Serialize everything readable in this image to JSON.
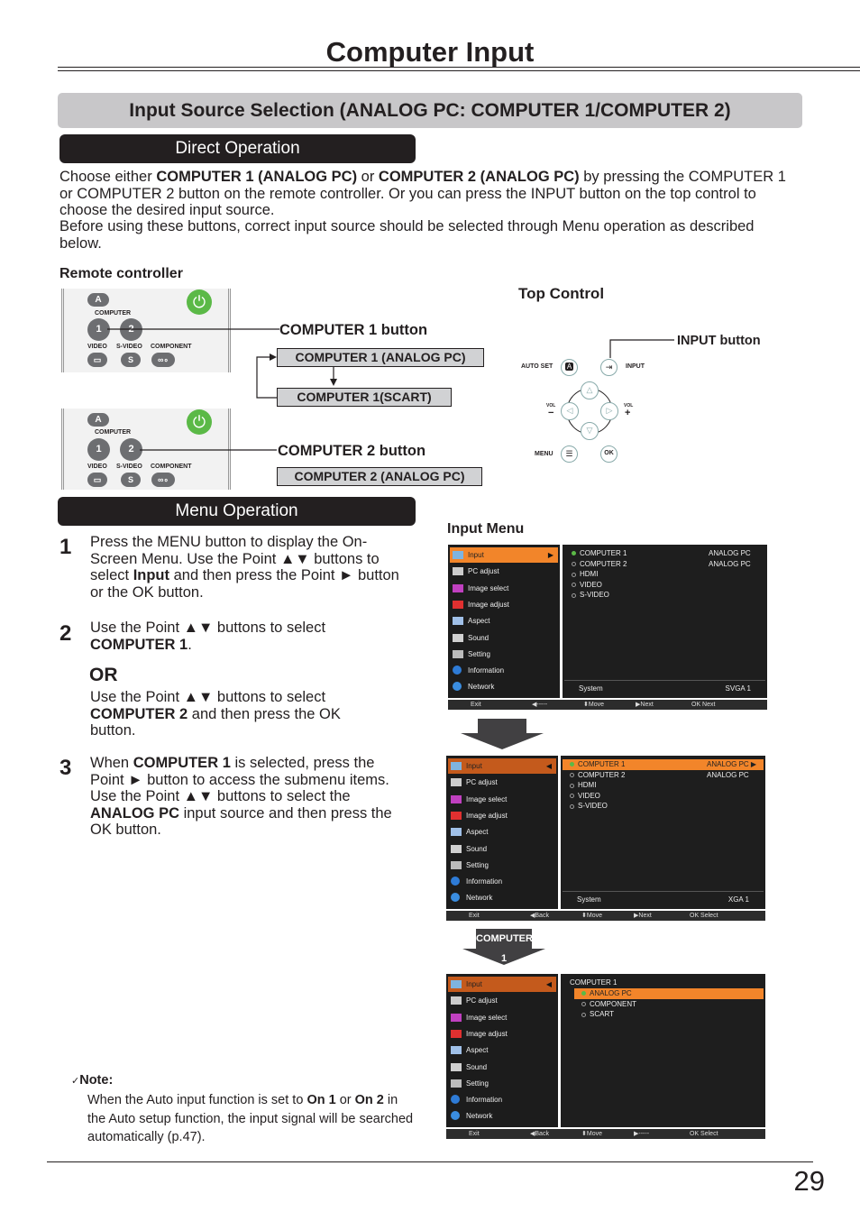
{
  "page": {
    "title": "Computer Input",
    "section_title": "Input Source Selection (ANALOG PC: COMPUTER 1/COMPUTER 2)",
    "page_number": "29"
  },
  "direct": {
    "heading": "Direct Operation",
    "para1_a": "Choose either ",
    "para1_b": "COMPUTER 1 (ANALOG PC)",
    "para1_c": " or ",
    "para1_d": "COMPUTER 2 (ANALOG PC)",
    "para1_e": " by pressing the COMPUTER 1 or COMPUTER 2 button on the remote controller. Or you can press the INPUT button on the top control to choose the desired input source.",
    "para2": "Before using these buttons, correct input source should be selected through Menu operation as described below.",
    "remote_label": "Remote controller",
    "top_control_label": "Top Control",
    "computer1_button": "COMPUTER 1 button",
    "computer1_analog": "COMPUTER 1 (ANALOG PC)",
    "computer1_scart": "COMPUTER 1(SCART)",
    "computer2_button": "COMPUTER 2 button",
    "computer2_analog": "COMPUTER 2 (ANALOG PC)",
    "input_button": "INPUT button"
  },
  "remote": {
    "auto_key": "A",
    "computer_label": "COMPUTER",
    "comp1": "1",
    "comp2": "2",
    "video": "VIDEO",
    "svideo": "S-VIDEO",
    "component": "COMPONENT",
    "power_glyph": "⏻",
    "video_glyph": "▭",
    "svideo_glyph": "S",
    "component_glyph": "∞∘"
  },
  "top_control": {
    "auto_set": "AUTO SET",
    "auto_key": "A",
    "input": "INPUT",
    "input_glyph": "⇥",
    "vol_minus_label": "VOL",
    "vol_minus": "−",
    "vol_plus_label": "VOL",
    "vol_plus": "+",
    "menu": "MENU",
    "menu_glyph": "☰",
    "ok": "OK",
    "up": "△",
    "down": "▽",
    "left": "◁",
    "right": "▷"
  },
  "menu_op": {
    "heading": "Menu Operation",
    "input_menu_label": "Input Menu",
    "step1_num": "1",
    "step1_a": "Press the MENU button to display the On-Screen Menu. Use the Point ▲▼ buttons to select ",
    "step1_b": "Input",
    "step1_c": " and then press the Point ► button or the OK button.",
    "step2_num": "2",
    "step2_a": "Use the Point ▲▼ buttons to select ",
    "step2_b": "COMPUTER 1",
    "step2_c": ".",
    "or": "OR",
    "step2alt_a": "Use the Point ▲▼ buttons to select ",
    "step2alt_b": "COMPUTER 2",
    "step2alt_c": " and then press the OK button.",
    "step3_num": "3",
    "step3_a": "When ",
    "step3_b": "COMPUTER 1",
    "step3_c": " is selected, press the Point ► button to access the submenu items. Use the Point ▲▼ buttons to select the ",
    "step3_d": "ANALOG PC",
    "step3_e": " input source and then press the OK button.",
    "arrow_label": "COMPUTER 1"
  },
  "note": {
    "check": "✓",
    "title": "Note:",
    "a": "When the Auto input function is set to ",
    "b": "On 1",
    "c": " or ",
    "d": "On 2",
    "e": " in the Auto setup function, the input signal will be searched automatically (p.47)."
  },
  "osd": {
    "left_items": [
      "Input",
      "PC adjust",
      "Image select",
      "Image adjust",
      "Aspect",
      "Sound",
      "Setting",
      "Information",
      "Network"
    ],
    "icon_colors": [
      "#7fb4e0",
      "#cccccc",
      "#c040c0",
      "#e03030",
      "#a0c0e8",
      "#d0d0d0",
      "#bbbbbb",
      "#2e7bd6",
      "#3a8de0"
    ],
    "screen1": {
      "rows": [
        {
          "name": "COMPUTER 1",
          "value": "ANALOG PC",
          "on": true
        },
        {
          "name": "COMPUTER 2",
          "value": "ANALOG PC",
          "on": false
        },
        {
          "name": "HDMI",
          "value": "",
          "on": false
        },
        {
          "name": "VIDEO",
          "value": "",
          "on": false
        },
        {
          "name": "S-VIDEO",
          "value": "",
          "on": false
        }
      ],
      "system_label": "System",
      "system_value": "SVGA 1",
      "footer": [
        "Exit",
        "◀-----",
        "⬍Move",
        "▶Next",
        "OK Next"
      ]
    },
    "screen2": {
      "rows": [
        {
          "name": "COMPUTER 1",
          "value": "ANALOG PC ▶",
          "on": true
        },
        {
          "name": "COMPUTER 2",
          "value": "ANALOG PC",
          "on": false
        },
        {
          "name": "HDMI",
          "value": "",
          "on": false
        },
        {
          "name": "VIDEO",
          "value": "",
          "on": false
        },
        {
          "name": "S-VIDEO",
          "value": "",
          "on": false
        }
      ],
      "system_label": "System",
      "system_value": "XGA 1",
      "footer": [
        "Exit",
        "◀Back",
        "⬍Move",
        "▶Next",
        "OK Select"
      ]
    },
    "screen3": {
      "header": "COMPUTER 1",
      "rows": [
        {
          "name": "ANALOG PC",
          "on": true
        },
        {
          "name": "COMPONENT",
          "on": false
        },
        {
          "name": "SCART",
          "on": false
        }
      ],
      "footer": [
        "Exit",
        "◀Back",
        "⬍Move",
        "▶-----",
        "OK Select"
      ]
    }
  },
  "colors": {
    "accent_orange": "#f2852a",
    "power_green": "#5bb947",
    "section_gray": "#c8c7c9"
  }
}
